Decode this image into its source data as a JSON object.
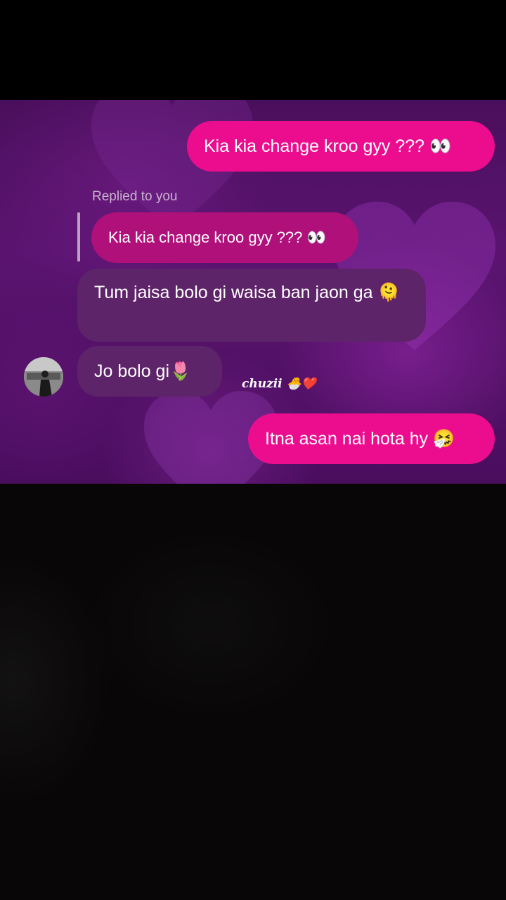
{
  "messages": {
    "sent_1": "Kia kia change kroo gyy ??? 👀",
    "replied_label": "Replied to you",
    "quoted": "Kia kia change kroo gyy ??? 👀",
    "received_1": "Tum jaisa bolo gi waisa ban jaon  ga 🫠",
    "received_2": "Jo bolo gi🌷",
    "sticker": "chuzii 🐣❤️",
    "sent_2": "Itna asan nai hota hy 🤧"
  },
  "colors": {
    "sent_bubble": "#ec0d8f",
    "received_bubble": "#5e2469",
    "quoted_bubble": "#b0107a",
    "background": "#4a0f5c"
  }
}
